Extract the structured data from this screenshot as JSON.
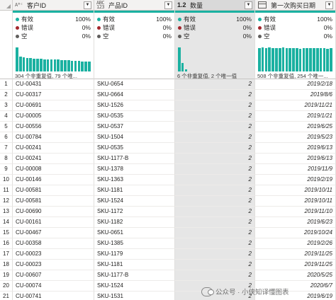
{
  "columns": [
    {
      "type_icon": "Aᴮᶜ",
      "name": "客户ID",
      "quality": {
        "valid_label": "有效",
        "valid_pct": "100%",
        "error_label": "错误",
        "error_pct": "0%",
        "empty_label": "空",
        "empty_pct": "0%"
      },
      "summary": "304 个非重复值, 79 个唯...",
      "hist": [
        1.0,
        0.62,
        0.58,
        0.56,
        0.55,
        0.54,
        0.53,
        0.52,
        0.51,
        0.5,
        0.5,
        0.49,
        0.49,
        0.48,
        0.47,
        0.46,
        0.45,
        0.44,
        0.43,
        0.42,
        0.41,
        0.4
      ]
    },
    {
      "type_icon": "ABC 123",
      "name": "产品ID",
      "quality": {
        "valid_label": "有效",
        "valid_pct": "100%",
        "error_label": "错误",
        "error_pct": "0%",
        "empty_label": "空",
        "empty_pct": "0%"
      },
      "summary": "",
      "hist": []
    },
    {
      "type_icon": "1.2",
      "name": "数量",
      "quality": {
        "valid_label": "有效",
        "valid_pct": "100%",
        "error_label": "错误",
        "error_pct": "0%",
        "empty_label": "空",
        "empty_pct": "0%"
      },
      "summary": "6 个非重复值, 2 个唯一值",
      "hist": [
        1.0,
        0.35,
        0.08,
        0,
        0,
        0,
        0,
        0,
        0,
        0,
        0,
        0,
        0,
        0,
        0,
        0,
        0,
        0,
        0,
        0,
        0,
        0
      ]
    },
    {
      "type_icon": "calendar-icon",
      "name": "第一次购买日期",
      "quality": {
        "valid_label": "有效",
        "valid_pct": "100%",
        "error_label": "错误",
        "error_pct": "0%",
        "empty_label": "空",
        "empty_pct": "0%"
      },
      "summary": "508 个非重复值, 254 个唯一...",
      "hist": [
        0.98,
        1.0,
        0.97,
        0.99,
        0.97,
        0.98,
        0.96,
        0.99,
        0.97,
        0.98,
        0.96,
        0.97,
        0.95,
        0.98,
        0.97,
        0.96,
        0.97,
        0.98,
        0.96,
        0.97,
        0.95,
        0.97
      ]
    }
  ],
  "rows": [
    {
      "n": "1",
      "c": "CU-00431",
      "p": "SKU-0654",
      "q": "2",
      "d": "2019/2/18"
    },
    {
      "n": "2",
      "c": "CU-00317",
      "p": "SKU-0664",
      "q": "2",
      "d": "2019/8/6"
    },
    {
      "n": "3",
      "c": "CU-00691",
      "p": "SKU-1526",
      "q": "2",
      "d": "2019/11/21"
    },
    {
      "n": "4",
      "c": "CU-00005",
      "p": "SKU-0535",
      "q": "2",
      "d": "2019/1/21"
    },
    {
      "n": "5",
      "c": "CU-00556",
      "p": "SKU-0537",
      "q": "2",
      "d": "2019/6/25"
    },
    {
      "n": "6",
      "c": "CU-00784",
      "p": "SKU-1504",
      "q": "2",
      "d": "2019/5/23"
    },
    {
      "n": "7",
      "c": "CU-00241",
      "p": "SKU-0535",
      "q": "2",
      "d": "2019/6/13"
    },
    {
      "n": "8",
      "c": "CU-00241",
      "p": "SKU-1177-B",
      "q": "2",
      "d": "2019/6/13"
    },
    {
      "n": "9",
      "c": "CU-00008",
      "p": "SKU-1378",
      "q": "2",
      "d": "2019/11/9"
    },
    {
      "n": "10",
      "c": "CU-00146",
      "p": "SKU-1363",
      "q": "2",
      "d": "2019/2/19"
    },
    {
      "n": "11",
      "c": "CU-00581",
      "p": "SKU-1181",
      "q": "2",
      "d": "2019/10/11"
    },
    {
      "n": "12",
      "c": "CU-00581",
      "p": "SKU-1524",
      "q": "2",
      "d": "2019/10/11"
    },
    {
      "n": "13",
      "c": "CU-00690",
      "p": "SKU-1172",
      "q": "2",
      "d": "2019/11/10"
    },
    {
      "n": "14",
      "c": "CU-00161",
      "p": "SKU-1182",
      "q": "2",
      "d": "2019/6/23"
    },
    {
      "n": "15",
      "c": "CU-00467",
      "p": "SKU-0651",
      "q": "2",
      "d": "2019/10/24"
    },
    {
      "n": "16",
      "c": "CU-00358",
      "p": "SKU-1385",
      "q": "2",
      "d": "2019/2/26"
    },
    {
      "n": "17",
      "c": "CU-00023",
      "p": "SKU-1179",
      "q": "2",
      "d": "2019/11/25"
    },
    {
      "n": "18",
      "c": "CU-00023",
      "p": "SKU-1181",
      "q": "2",
      "d": "2019/11/25"
    },
    {
      "n": "19",
      "c": "CU-00607",
      "p": "SKU-1177-B",
      "q": "2",
      "d": "2020/5/25"
    },
    {
      "n": "20",
      "c": "CU-00074",
      "p": "SKU-1524",
      "q": "2",
      "d": "2020/6/7"
    },
    {
      "n": "21",
      "c": "CU-00741",
      "p": "SKU-1531",
      "q": "2",
      "d": "2019/6/19"
    }
  ],
  "watermark": "公众号 · 小侠知译懂图表",
  "colors": {
    "accent": "#1bb1a1",
    "error": "#a4262c",
    "empty": "#605e5c",
    "selected_col": "#d9d9d9"
  }
}
